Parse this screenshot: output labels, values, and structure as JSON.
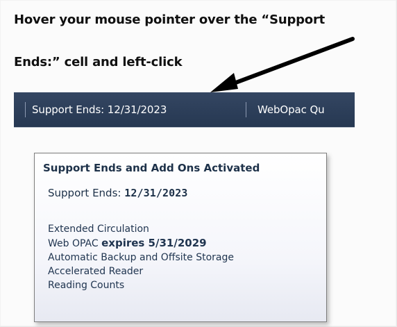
{
  "instruction": {
    "line1": "Hover your mouse pointer over the “Support",
    "line2": "Ends:” cell and left-click"
  },
  "toolbar": {
    "support_ends_cell": "Support Ends: 12/31/2023",
    "webopac_cell": "WebOpac Qu"
  },
  "tooltip": {
    "title": "Support Ends and Add Ons Activated",
    "support_label": "Support Ends: ",
    "support_date": "12/31/2023",
    "addons": {
      "extended_circulation": "Extended Circulation",
      "web_opac": "Web OPAC ",
      "web_opac_expiry": "expires 5/31/2029",
      "automatic_backup": "Automatic Backup and Offsite Storage",
      "accelerated_reader": "Accelerated Reader",
      "reading_counts": "Reading Counts"
    }
  },
  "colors": {
    "toolbar": "#2f4058",
    "tooltip_text": "#1d3149",
    "arrow": "#000000"
  },
  "icons": {
    "arrow": "pointer-arrow-icon"
  }
}
